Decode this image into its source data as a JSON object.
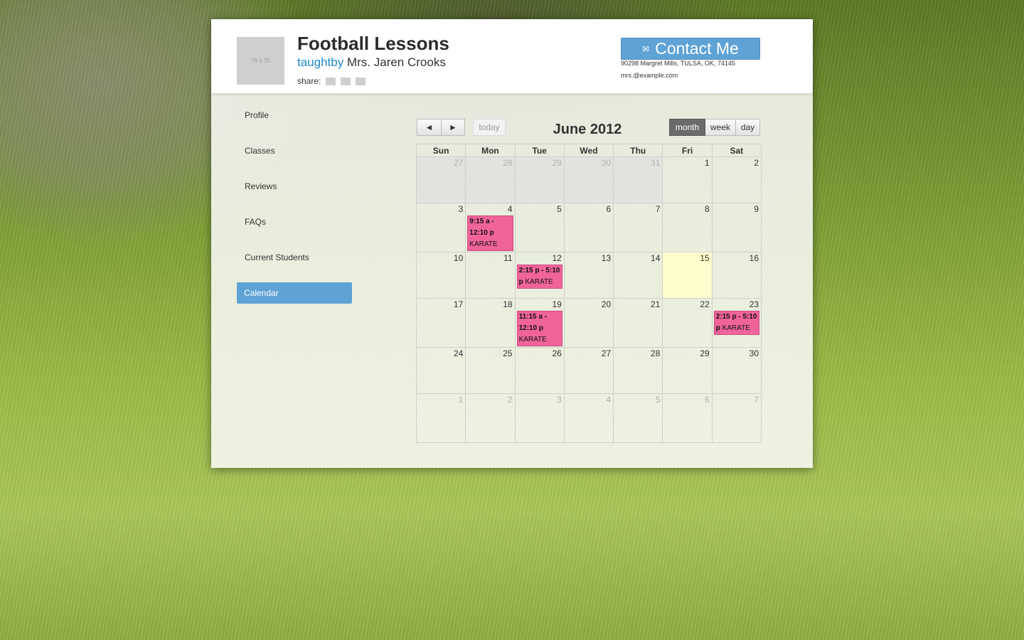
{
  "header": {
    "avatar_placeholder": "75 x 75",
    "title": "Football Lessons",
    "taught_keyword": "taughtby",
    "teacher": "Mrs. Jaren Crooks",
    "share_label": "share:",
    "contact_label": "Contact Me",
    "address": "90298 Margret Mills, TULSA, OK, 74145",
    "email": "mrs.@example.com"
  },
  "nav": {
    "items": [
      {
        "label": "Profile"
      },
      {
        "label": "Classes"
      },
      {
        "label": "Reviews"
      },
      {
        "label": "FAQs"
      },
      {
        "label": "Current Students"
      },
      {
        "label": "Calendar",
        "active": true
      }
    ]
  },
  "calendar": {
    "prev_label": "◄",
    "next_label": "►",
    "today_label": "today",
    "title": "June 2012",
    "views": [
      "month",
      "week",
      "day"
    ],
    "active_view": "month",
    "weekdays": [
      "Sun",
      "Mon",
      "Tue",
      "Wed",
      "Thu",
      "Fri",
      "Sat"
    ],
    "weeks": [
      [
        {
          "d": "27",
          "o": "prev"
        },
        {
          "d": "28",
          "o": "prev"
        },
        {
          "d": "29",
          "o": "prev"
        },
        {
          "d": "30",
          "o": "prev"
        },
        {
          "d": "31",
          "o": "prev"
        },
        {
          "d": "1"
        },
        {
          "d": "2"
        }
      ],
      [
        {
          "d": "3"
        },
        {
          "d": "4",
          "event": {
            "time": "9:15 a - 12:10 p",
            "title": "KARATE"
          }
        },
        {
          "d": "5"
        },
        {
          "d": "6"
        },
        {
          "d": "7"
        },
        {
          "d": "8"
        },
        {
          "d": "9"
        }
      ],
      [
        {
          "d": "10"
        },
        {
          "d": "11"
        },
        {
          "d": "12",
          "event": {
            "time": "2:15 p - 5:10 p",
            "title": "KARATE"
          }
        },
        {
          "d": "13"
        },
        {
          "d": "14"
        },
        {
          "d": "15",
          "today": true
        },
        {
          "d": "16"
        }
      ],
      [
        {
          "d": "17"
        },
        {
          "d": "18"
        },
        {
          "d": "19",
          "event": {
            "time": "11:15 a - 12:10 p",
            "title": "KARATE"
          }
        },
        {
          "d": "20"
        },
        {
          "d": "21"
        },
        {
          "d": "22"
        },
        {
          "d": "23",
          "event": {
            "time": "2:15 p - 5:10 p",
            "title": "KARATE"
          }
        }
      ],
      [
        {
          "d": "24"
        },
        {
          "d": "25"
        },
        {
          "d": "26"
        },
        {
          "d": "27"
        },
        {
          "d": "28"
        },
        {
          "d": "29"
        },
        {
          "d": "30"
        }
      ],
      [
        {
          "d": "1",
          "o": "next"
        },
        {
          "d": "2",
          "o": "next"
        },
        {
          "d": "3",
          "o": "next"
        },
        {
          "d": "4",
          "o": "next"
        },
        {
          "d": "5",
          "o": "next"
        },
        {
          "d": "6",
          "o": "next"
        },
        {
          "d": "7",
          "o": "next"
        }
      ]
    ],
    "colors": {
      "event": "#f0649a",
      "today": "#fffccc",
      "accent": "#5ea2d6"
    }
  }
}
